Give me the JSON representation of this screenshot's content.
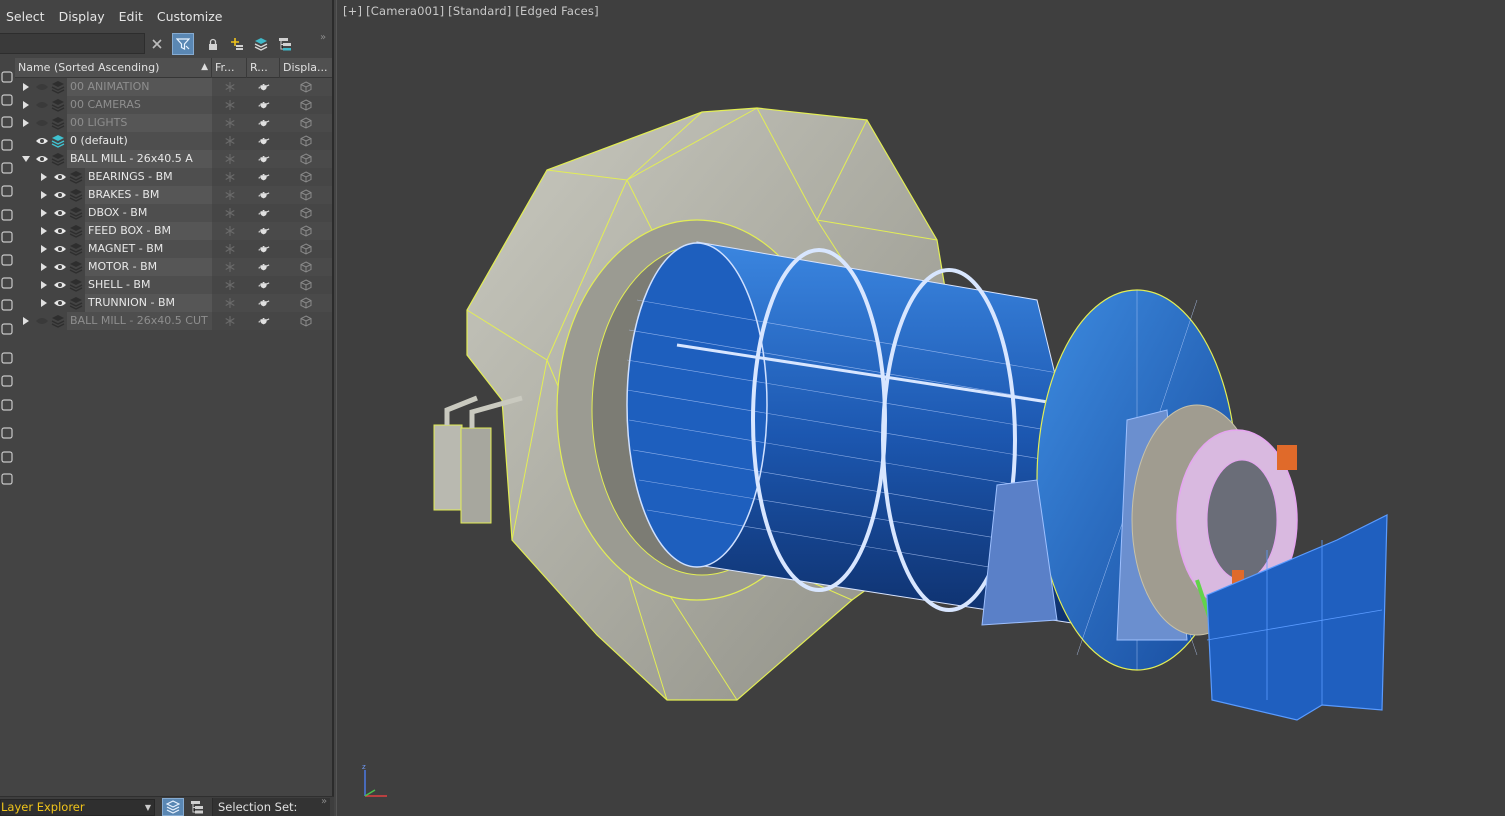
{
  "menu": [
    "Select",
    "Display",
    "Edit",
    "Customize"
  ],
  "toolbar": {
    "search_value": "",
    "icons": [
      "close-icon",
      "filter-icon",
      "lock-icon",
      "add-layer-icon",
      "layers-icon",
      "hierarchy-icon"
    ]
  },
  "table": {
    "headers": [
      "Name (Sorted Ascending)",
      "Fr...",
      "R...",
      "Displa..."
    ],
    "rows": [
      {
        "name": "00 ANIMATION",
        "level": 0,
        "expander": "collapsed",
        "visible": false,
        "dim": true
      },
      {
        "name": "00 CAMERAS",
        "level": 0,
        "expander": "collapsed",
        "visible": false,
        "dim": true
      },
      {
        "name": "00 LIGHTS",
        "level": 0,
        "expander": "collapsed",
        "visible": false,
        "dim": true
      },
      {
        "name": "0 (default)",
        "level": 0,
        "expander": "none",
        "visible": true,
        "dim": false,
        "active": true
      },
      {
        "name": "BALL MILL - 26x40.5  A",
        "level": 0,
        "expander": "expanded",
        "visible": true,
        "dim": false
      },
      {
        "name": "BEARINGS - BM",
        "level": 1,
        "expander": "collapsed",
        "visible": true,
        "dim": false
      },
      {
        "name": "BRAKES - BM",
        "level": 1,
        "expander": "collapsed",
        "visible": true,
        "dim": false
      },
      {
        "name": "DBOX - BM",
        "level": 1,
        "expander": "collapsed",
        "visible": true,
        "dim": false
      },
      {
        "name": "FEED BOX - BM",
        "level": 1,
        "expander": "collapsed",
        "visible": true,
        "dim": false
      },
      {
        "name": "MAGNET - BM",
        "level": 1,
        "expander": "collapsed",
        "visible": true,
        "dim": false
      },
      {
        "name": "MOTOR - BM",
        "level": 1,
        "expander": "collapsed",
        "visible": true,
        "dim": false
      },
      {
        "name": "SHELL - BM",
        "level": 1,
        "expander": "collapsed",
        "visible": true,
        "dim": false
      },
      {
        "name": "TRUNNION - BM",
        "level": 1,
        "expander": "collapsed",
        "visible": true,
        "dim": false
      },
      {
        "name": "BALL MILL - 26x40.5  CUT",
        "level": 0,
        "expander": "collapsed",
        "visible": false,
        "dim": true
      }
    ]
  },
  "bottom": {
    "explorer": "Layer Explorer",
    "selection_set_label": "Selection Set:"
  },
  "viewport": {
    "label": "[+] [Camera001] [Standard] [Edged Faces]"
  },
  "colors": {
    "panel_bg": "#444444",
    "viewport_bg": "#3f3f3f",
    "accent": "#5a87b3",
    "explorer_text": "#f0c419",
    "wire_yellow": "#e6ef55",
    "shell_blue": "#1f5fbf"
  }
}
